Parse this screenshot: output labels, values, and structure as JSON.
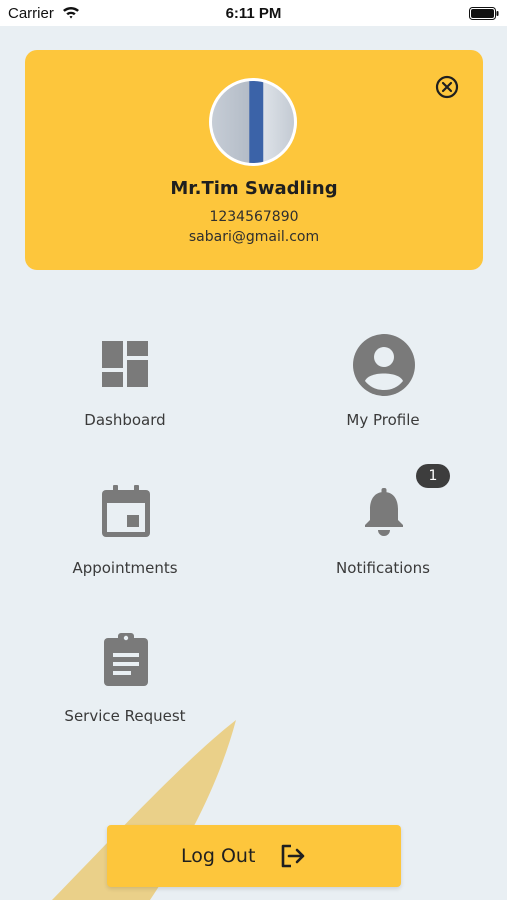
{
  "status_bar": {
    "carrier": "Carrier",
    "time": "6:11 PM",
    "wifi_icon": "wifi-icon",
    "battery_icon": "battery-icon"
  },
  "profile": {
    "name": "Mr.Tim Swadling",
    "phone": "1234567890",
    "email": "sabari@gmail.com",
    "close_icon": "close-circle-icon"
  },
  "menu": {
    "items": [
      {
        "label": "Dashboard",
        "icon": "dashboard-icon"
      },
      {
        "label": "My Profile",
        "icon": "account-circle-icon"
      },
      {
        "label": "Appointments",
        "icon": "calendar-icon"
      },
      {
        "label": "Notifications",
        "icon": "bell-icon",
        "badge": "1"
      },
      {
        "label": "Service Request",
        "icon": "clipboard-icon"
      }
    ]
  },
  "logout": {
    "label": "Log Out",
    "icon": "logout-icon"
  },
  "colors": {
    "accent": "#fdc63c",
    "background": "#e9eff3",
    "icon": "#7a7a7a",
    "badge": "#3d3d3d"
  }
}
